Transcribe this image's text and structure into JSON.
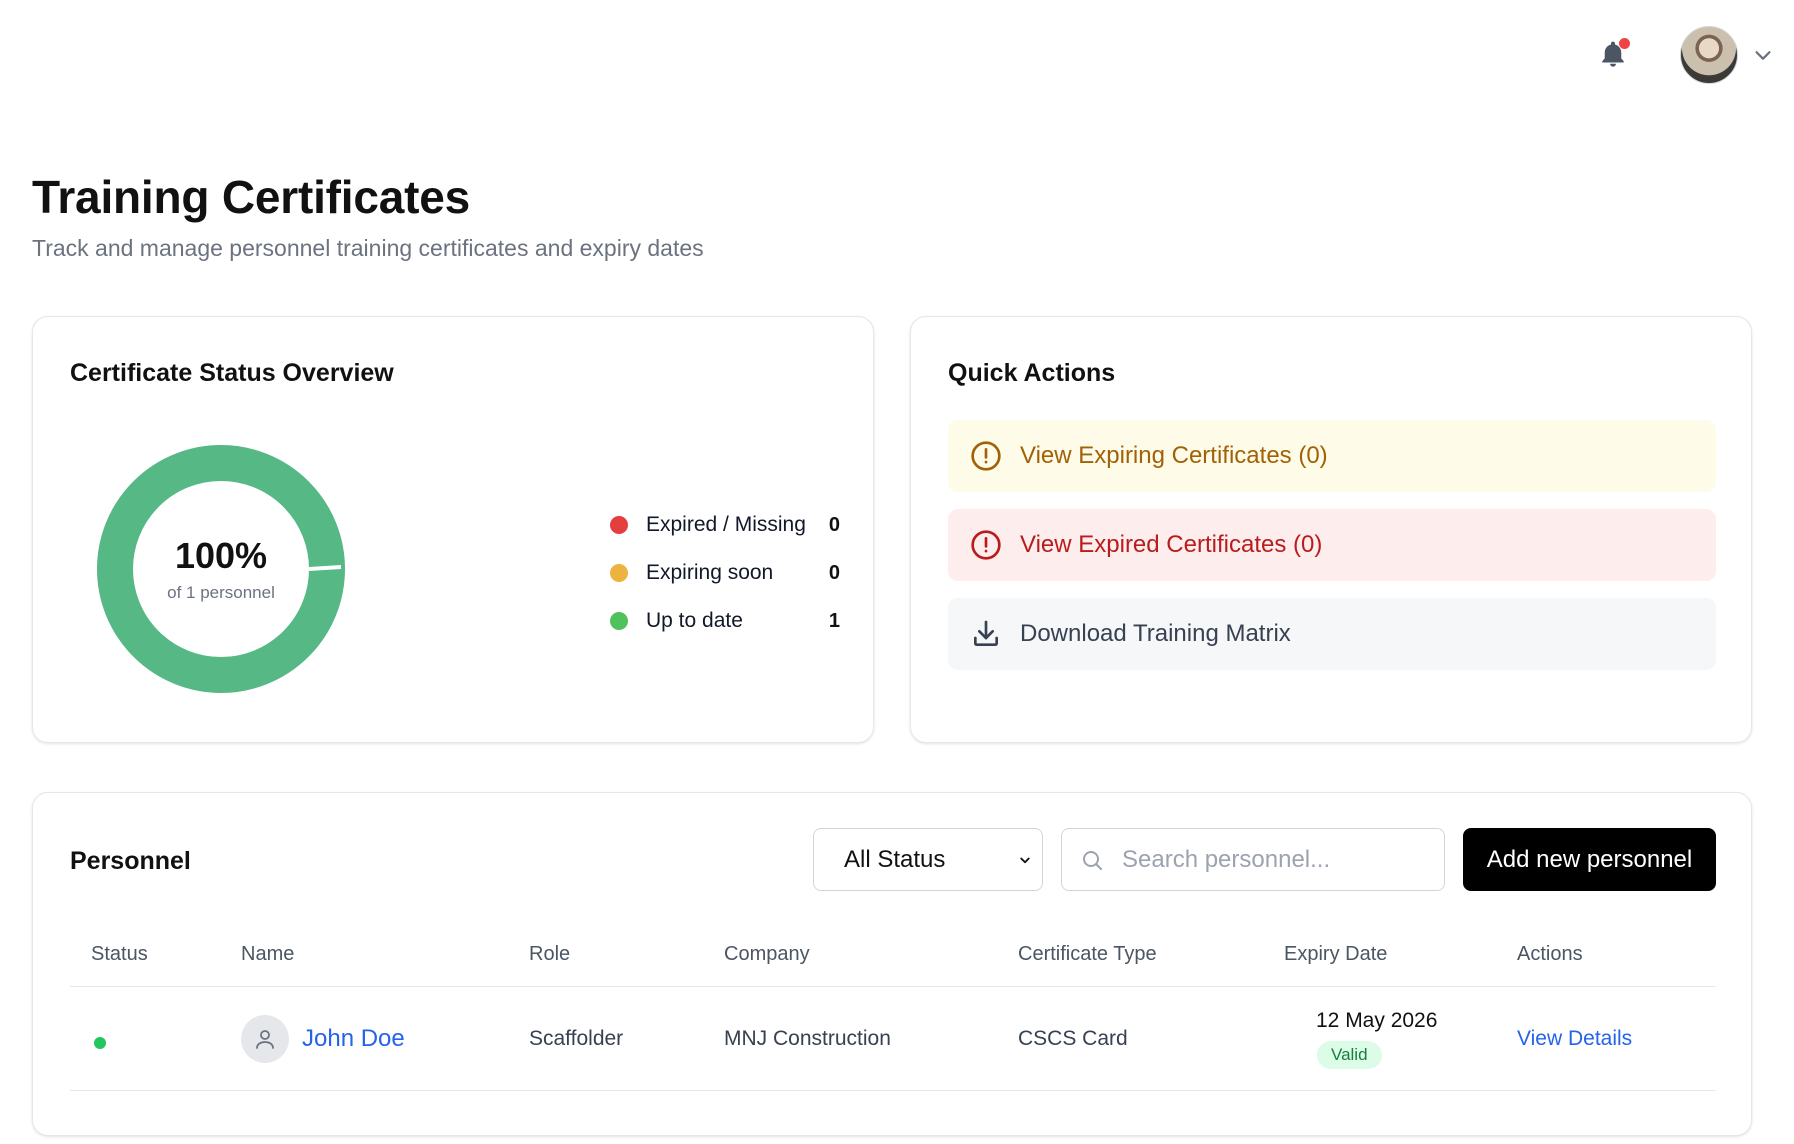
{
  "header": {
    "title": "Training Certificates",
    "subtitle": "Track and manage personnel training certificates and expiry dates"
  },
  "topbar": {
    "notification_icon": "bell-icon",
    "has_unread": true,
    "avatar": "user-avatar",
    "menu_icon": "chevron-down-icon"
  },
  "overview": {
    "title": "Certificate Status Overview",
    "percent": "100%",
    "caption": "of 1 personnel",
    "donut_fill": 1.0,
    "legend": [
      {
        "label": "Expired / Missing",
        "count": "0",
        "color": "#e53e3e"
      },
      {
        "label": "Expiring soon",
        "count": "0",
        "color": "#ecb43f"
      },
      {
        "label": "Up to date",
        "count": "1",
        "color": "#4fc25e"
      }
    ],
    "donut_color": "#56b884"
  },
  "quick_actions": {
    "title": "Quick Actions",
    "items": [
      {
        "label": "View Expiring Certificates (0)",
        "icon": "alert-circle-icon"
      },
      {
        "label": "View Expired Certificates (0)",
        "icon": "alert-circle-icon"
      },
      {
        "label": "Download Training Matrix",
        "icon": "download-icon"
      }
    ]
  },
  "personnel": {
    "title": "Personnel",
    "filter_value": "All Status",
    "search_placeholder": "Search personnel...",
    "add_label": "Add new personnel",
    "columns": [
      "Status",
      "Name",
      "Role",
      "Company",
      "Certificate Type",
      "Expiry Date",
      "Actions"
    ],
    "rows": [
      {
        "status_color": "#22c55e",
        "name": "John Doe",
        "role": "Scaffolder",
        "company": "MNJ Construction",
        "certificate_type": "CSCS Card",
        "expiry_date": "12 May 2026",
        "expiry_status": "Valid",
        "action": "View Details"
      }
    ]
  }
}
